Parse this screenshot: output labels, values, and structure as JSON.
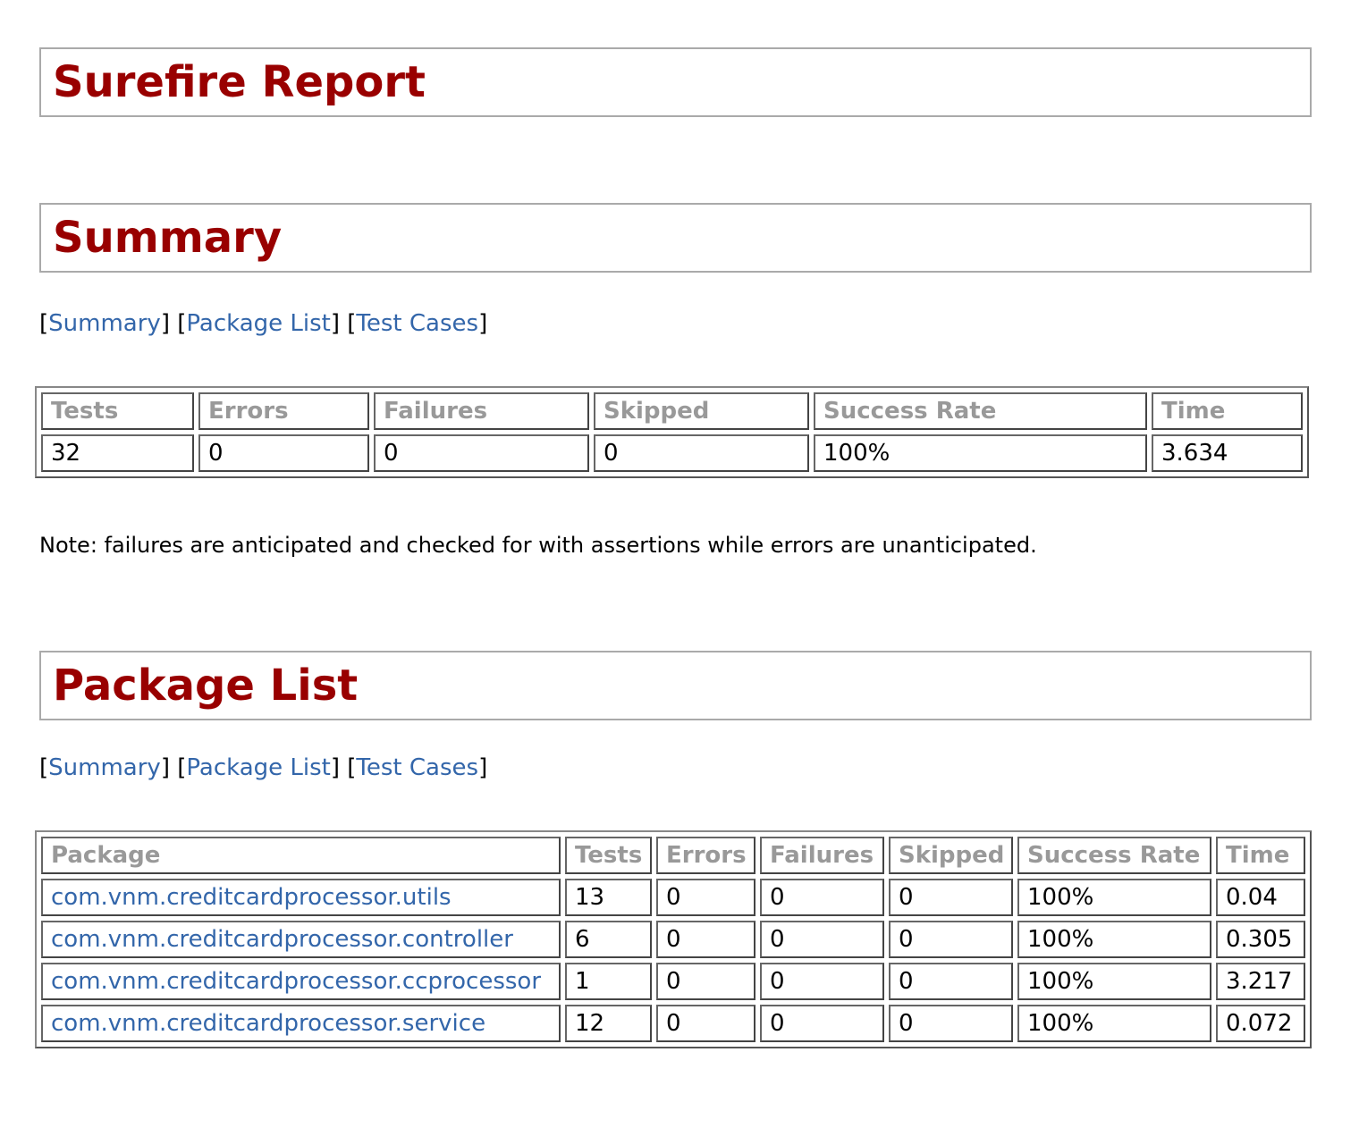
{
  "report_title": "Surefire Report",
  "summary": {
    "heading": "Summary",
    "nav": [
      {
        "label": "Summary"
      },
      {
        "label": "Package List"
      },
      {
        "label": "Test Cases"
      }
    ],
    "columns": [
      "Tests",
      "Errors",
      "Failures",
      "Skipped",
      "Success Rate",
      "Time"
    ],
    "row": [
      "32",
      "0",
      "0",
      "0",
      "100%",
      "3.634"
    ],
    "note": "Note: failures are anticipated and checked for with assertions while errors are unanticipated."
  },
  "package_list": {
    "heading": "Package List",
    "nav": [
      {
        "label": "Summary"
      },
      {
        "label": "Package List"
      },
      {
        "label": "Test Cases"
      }
    ],
    "columns": [
      "Package",
      "Tests",
      "Errors",
      "Failures",
      "Skipped",
      "Success Rate",
      "Time"
    ],
    "rows": [
      [
        "com.vnm.creditcardprocessor.utils",
        "13",
        "0",
        "0",
        "0",
        "100%",
        "0.04"
      ],
      [
        "com.vnm.creditcardprocessor.controller",
        "6",
        "0",
        "0",
        "0",
        "100%",
        "0.305"
      ],
      [
        "com.vnm.creditcardprocessor.ccprocessor",
        "1",
        "0",
        "0",
        "0",
        "100%",
        "3.217"
      ],
      [
        "com.vnm.creditcardprocessor.service",
        "12",
        "0",
        "0",
        "0",
        "100%",
        "0.072"
      ]
    ]
  },
  "colors": {
    "heading": "#990000",
    "link": "#3366aa",
    "header_text": "#999999"
  }
}
